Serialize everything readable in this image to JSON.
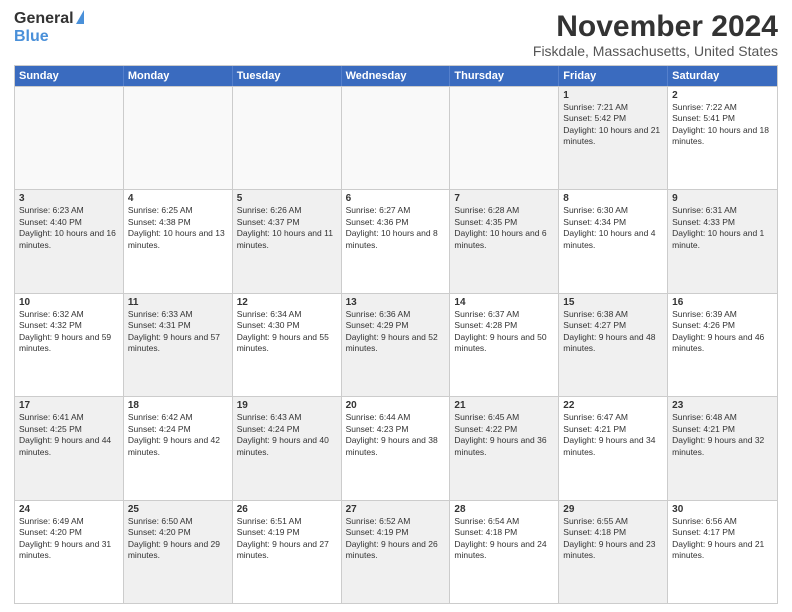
{
  "logo": {
    "general": "General",
    "blue": "Blue"
  },
  "header": {
    "title": "November 2024",
    "subtitle": "Fiskdale, Massachusetts, United States"
  },
  "calendar": {
    "days": [
      "Sunday",
      "Monday",
      "Tuesday",
      "Wednesday",
      "Thursday",
      "Friday",
      "Saturday"
    ],
    "rows": [
      [
        {
          "day": "",
          "info": "",
          "empty": true
        },
        {
          "day": "",
          "info": "",
          "empty": true
        },
        {
          "day": "",
          "info": "",
          "empty": true
        },
        {
          "day": "",
          "info": "",
          "empty": true
        },
        {
          "day": "",
          "info": "",
          "empty": true
        },
        {
          "day": "1",
          "info": "Sunrise: 7:21 AM\nSunset: 5:42 PM\nDaylight: 10 hours and 21 minutes.",
          "shaded": true
        },
        {
          "day": "2",
          "info": "Sunrise: 7:22 AM\nSunset: 5:41 PM\nDaylight: 10 hours and 18 minutes.",
          "shaded": false
        }
      ],
      [
        {
          "day": "3",
          "info": "Sunrise: 6:23 AM\nSunset: 4:40 PM\nDaylight: 10 hours and 16 minutes.",
          "shaded": true
        },
        {
          "day": "4",
          "info": "Sunrise: 6:25 AM\nSunset: 4:38 PM\nDaylight: 10 hours and 13 minutes.",
          "shaded": false
        },
        {
          "day": "5",
          "info": "Sunrise: 6:26 AM\nSunset: 4:37 PM\nDaylight: 10 hours and 11 minutes.",
          "shaded": true
        },
        {
          "day": "6",
          "info": "Sunrise: 6:27 AM\nSunset: 4:36 PM\nDaylight: 10 hours and 8 minutes.",
          "shaded": false
        },
        {
          "day": "7",
          "info": "Sunrise: 6:28 AM\nSunset: 4:35 PM\nDaylight: 10 hours and 6 minutes.",
          "shaded": true
        },
        {
          "day": "8",
          "info": "Sunrise: 6:30 AM\nSunset: 4:34 PM\nDaylight: 10 hours and 4 minutes.",
          "shaded": false
        },
        {
          "day": "9",
          "info": "Sunrise: 6:31 AM\nSunset: 4:33 PM\nDaylight: 10 hours and 1 minute.",
          "shaded": true
        }
      ],
      [
        {
          "day": "10",
          "info": "Sunrise: 6:32 AM\nSunset: 4:32 PM\nDaylight: 9 hours and 59 minutes.",
          "shaded": false
        },
        {
          "day": "11",
          "info": "Sunrise: 6:33 AM\nSunset: 4:31 PM\nDaylight: 9 hours and 57 minutes.",
          "shaded": true
        },
        {
          "day": "12",
          "info": "Sunrise: 6:34 AM\nSunset: 4:30 PM\nDaylight: 9 hours and 55 minutes.",
          "shaded": false
        },
        {
          "day": "13",
          "info": "Sunrise: 6:36 AM\nSunset: 4:29 PM\nDaylight: 9 hours and 52 minutes.",
          "shaded": true
        },
        {
          "day": "14",
          "info": "Sunrise: 6:37 AM\nSunset: 4:28 PM\nDaylight: 9 hours and 50 minutes.",
          "shaded": false
        },
        {
          "day": "15",
          "info": "Sunrise: 6:38 AM\nSunset: 4:27 PM\nDaylight: 9 hours and 48 minutes.",
          "shaded": true
        },
        {
          "day": "16",
          "info": "Sunrise: 6:39 AM\nSunset: 4:26 PM\nDaylight: 9 hours and 46 minutes.",
          "shaded": false
        }
      ],
      [
        {
          "day": "17",
          "info": "Sunrise: 6:41 AM\nSunset: 4:25 PM\nDaylight: 9 hours and 44 minutes.",
          "shaded": true
        },
        {
          "day": "18",
          "info": "Sunrise: 6:42 AM\nSunset: 4:24 PM\nDaylight: 9 hours and 42 minutes.",
          "shaded": false
        },
        {
          "day": "19",
          "info": "Sunrise: 6:43 AM\nSunset: 4:24 PM\nDaylight: 9 hours and 40 minutes.",
          "shaded": true
        },
        {
          "day": "20",
          "info": "Sunrise: 6:44 AM\nSunset: 4:23 PM\nDaylight: 9 hours and 38 minutes.",
          "shaded": false
        },
        {
          "day": "21",
          "info": "Sunrise: 6:45 AM\nSunset: 4:22 PM\nDaylight: 9 hours and 36 minutes.",
          "shaded": true
        },
        {
          "day": "22",
          "info": "Sunrise: 6:47 AM\nSunset: 4:21 PM\nDaylight: 9 hours and 34 minutes.",
          "shaded": false
        },
        {
          "day": "23",
          "info": "Sunrise: 6:48 AM\nSunset: 4:21 PM\nDaylight: 9 hours and 32 minutes.",
          "shaded": true
        }
      ],
      [
        {
          "day": "24",
          "info": "Sunrise: 6:49 AM\nSunset: 4:20 PM\nDaylight: 9 hours and 31 minutes.",
          "shaded": false
        },
        {
          "day": "25",
          "info": "Sunrise: 6:50 AM\nSunset: 4:20 PM\nDaylight: 9 hours and 29 minutes.",
          "shaded": true
        },
        {
          "day": "26",
          "info": "Sunrise: 6:51 AM\nSunset: 4:19 PM\nDaylight: 9 hours and 27 minutes.",
          "shaded": false
        },
        {
          "day": "27",
          "info": "Sunrise: 6:52 AM\nSunset: 4:19 PM\nDaylight: 9 hours and 26 minutes.",
          "shaded": true
        },
        {
          "day": "28",
          "info": "Sunrise: 6:54 AM\nSunset: 4:18 PM\nDaylight: 9 hours and 24 minutes.",
          "shaded": false
        },
        {
          "day": "29",
          "info": "Sunrise: 6:55 AM\nSunset: 4:18 PM\nDaylight: 9 hours and 23 minutes.",
          "shaded": true
        },
        {
          "day": "30",
          "info": "Sunrise: 6:56 AM\nSunset: 4:17 PM\nDaylight: 9 hours and 21 minutes.",
          "shaded": false
        }
      ]
    ]
  }
}
